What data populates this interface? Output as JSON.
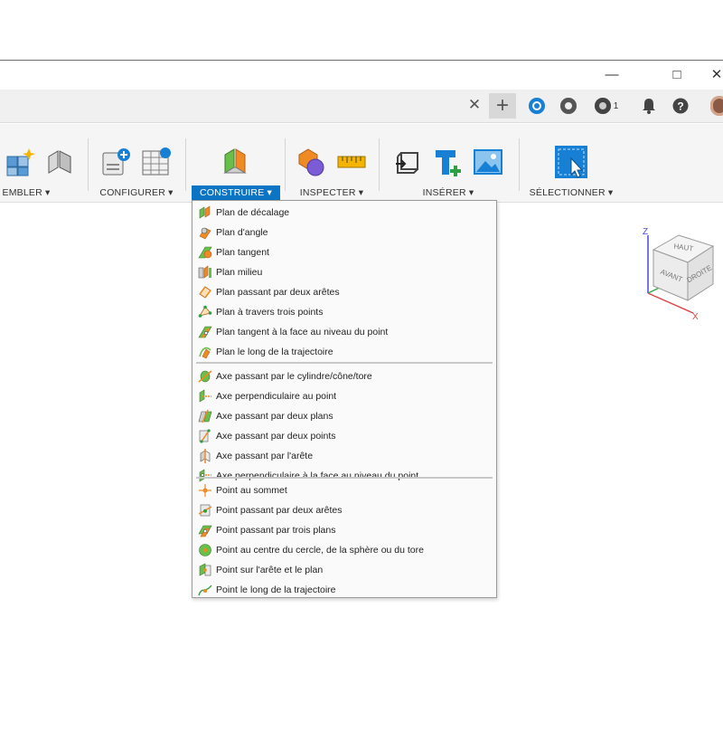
{
  "window": {
    "controls": {
      "minimize": "—",
      "maximize": "□",
      "close": "✕"
    }
  },
  "tabbar": {
    "close_glyph": "✕",
    "add_glyph": "+",
    "job_count": "1",
    "icons": [
      "data-panel-icon",
      "sync-icon",
      "job-status-icon",
      "notifications-icon",
      "help-icon",
      "avatar"
    ]
  },
  "toolbar": {
    "groups": [
      {
        "label": "ASSEMBLER",
        "visible_label": "EMBLER ▾"
      },
      {
        "label": "CONFIGURER ▾"
      },
      {
        "label": "CONSTRUIRE ▾",
        "active": true
      },
      {
        "label": "INSPECTER ▾"
      },
      {
        "label": "INSÉRER ▾"
      },
      {
        "label": "SÉLECTIONNER ▾"
      }
    ],
    "accent": "#0b74c5"
  },
  "menu": {
    "planes": [
      {
        "label": "Plan de décalage",
        "icon": "offset-plane-icon"
      },
      {
        "label": "Plan d'angle",
        "icon": "plane-at-angle-icon"
      },
      {
        "label": "Plan tangent",
        "icon": "tangent-plane-icon"
      },
      {
        "label": "Plan milieu",
        "icon": "midplane-icon"
      },
      {
        "label": "Plan passant par deux arêtes",
        "icon": "plane-two-edges-icon"
      },
      {
        "label": "Plan à travers trois points",
        "icon": "plane-three-points-icon"
      },
      {
        "label": "Plan tangent à la face au niveau du point",
        "icon": "plane-tangent-face-point-icon"
      },
      {
        "label": "Plan le long de la trajectoire",
        "icon": "plane-along-path-icon"
      }
    ],
    "axes": [
      {
        "label": "Axe passant par le cylindre/cône/tore",
        "icon": "axis-cylinder-icon"
      },
      {
        "label": "Axe perpendiculaire au point",
        "icon": "axis-perp-point-icon"
      },
      {
        "label": "Axe passant par deux plans",
        "icon": "axis-two-planes-icon"
      },
      {
        "label": "Axe passant par deux points",
        "icon": "axis-two-points-icon"
      },
      {
        "label": "Axe passant par l'arête",
        "icon": "axis-edge-icon"
      },
      {
        "label": "Axe perpendiculaire à la face au niveau du point",
        "icon": "axis-perp-face-icon"
      }
    ],
    "points": [
      {
        "label": "Point au sommet",
        "icon": "point-vertex-icon"
      },
      {
        "label": "Point passant par deux arêtes",
        "icon": "point-two-edges-icon"
      },
      {
        "label": "Point passant par trois plans",
        "icon": "point-three-planes-icon"
      },
      {
        "label": "Point au centre du cercle, de la sphère ou du tore",
        "icon": "point-center-icon"
      },
      {
        "label": "Point sur l'arête et le plan",
        "icon": "point-edge-plane-icon"
      },
      {
        "label": "Point le long de la trajectoire",
        "icon": "point-along-path-icon"
      }
    ]
  },
  "viewcube": {
    "faces": {
      "top": "HAUT",
      "front": "AVANT",
      "right": "DROITE"
    },
    "axes": {
      "z": "Z",
      "x": "X"
    }
  }
}
